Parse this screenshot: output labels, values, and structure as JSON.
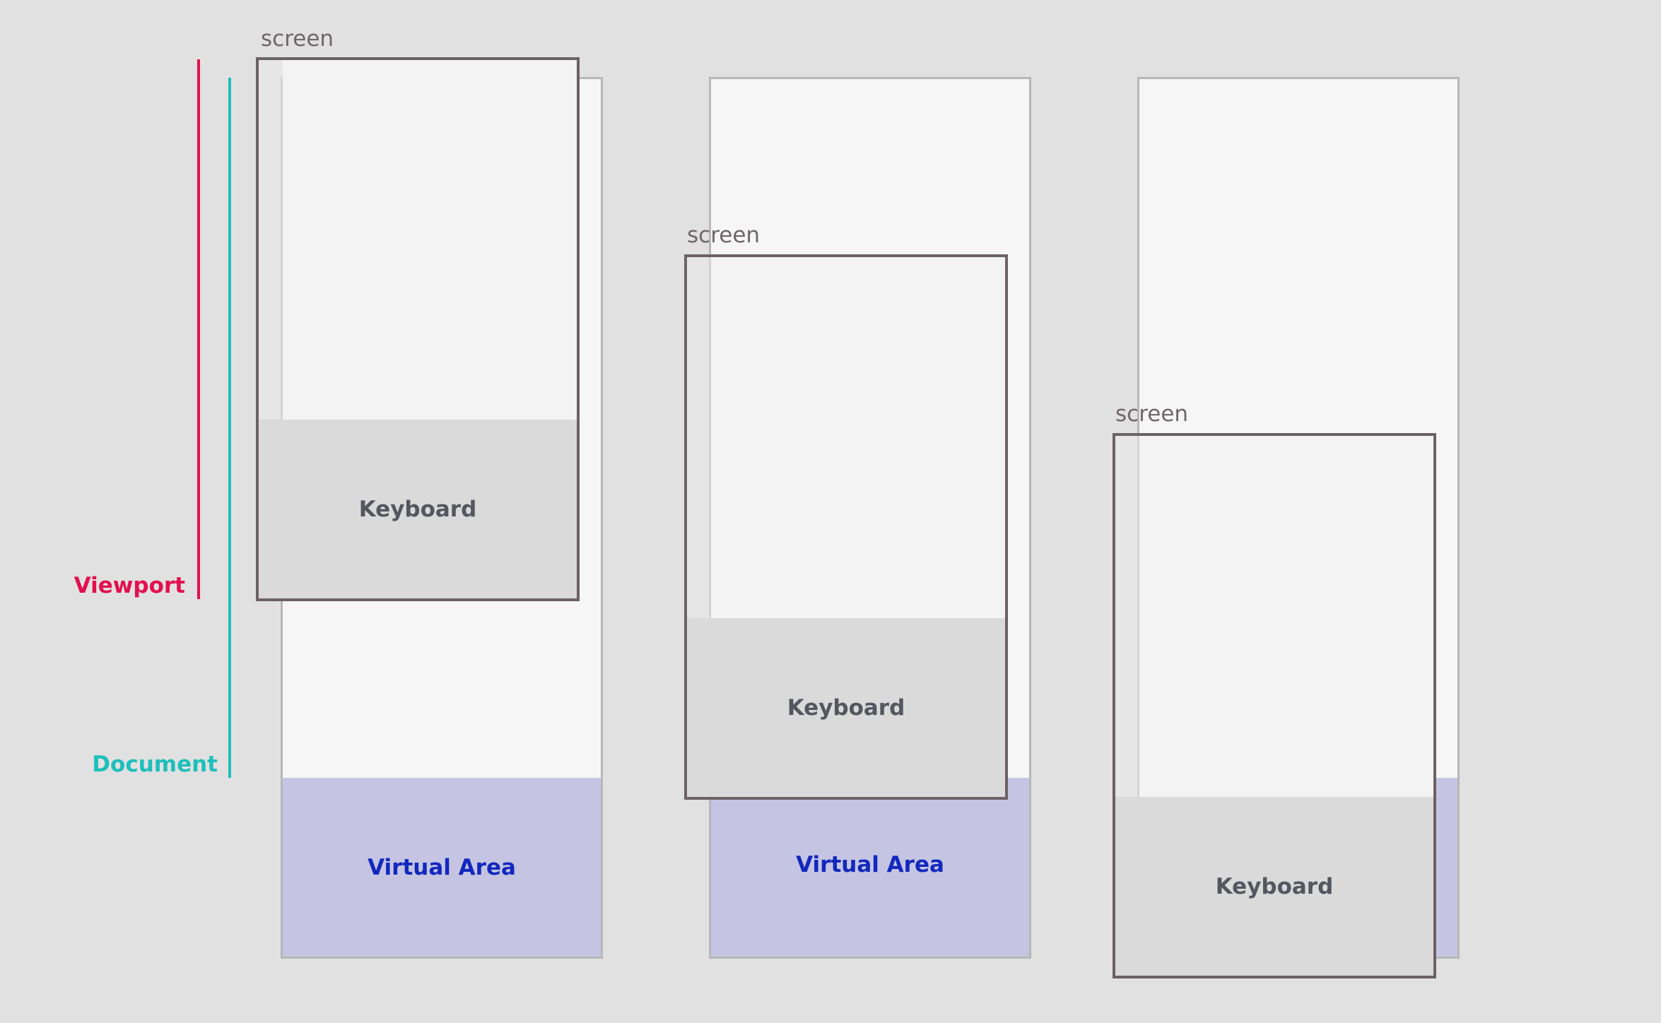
{
  "labels": {
    "screen": "screen",
    "keyboard": "Keyboard",
    "virtual_area": "Virtual Area",
    "viewport": "Viewport",
    "document": "Document"
  },
  "colors": {
    "background": "#e1e1e1",
    "document": "#f6f6f6",
    "virtual_area": "#c5c5e3",
    "virtual_area_text": "#1228bd",
    "keyboard": "#dadada",
    "keyboard_text": "#555760",
    "screen_border": "#6b6265",
    "viewport": "#e3104f",
    "document_bracket": "#1ebfbb"
  }
}
